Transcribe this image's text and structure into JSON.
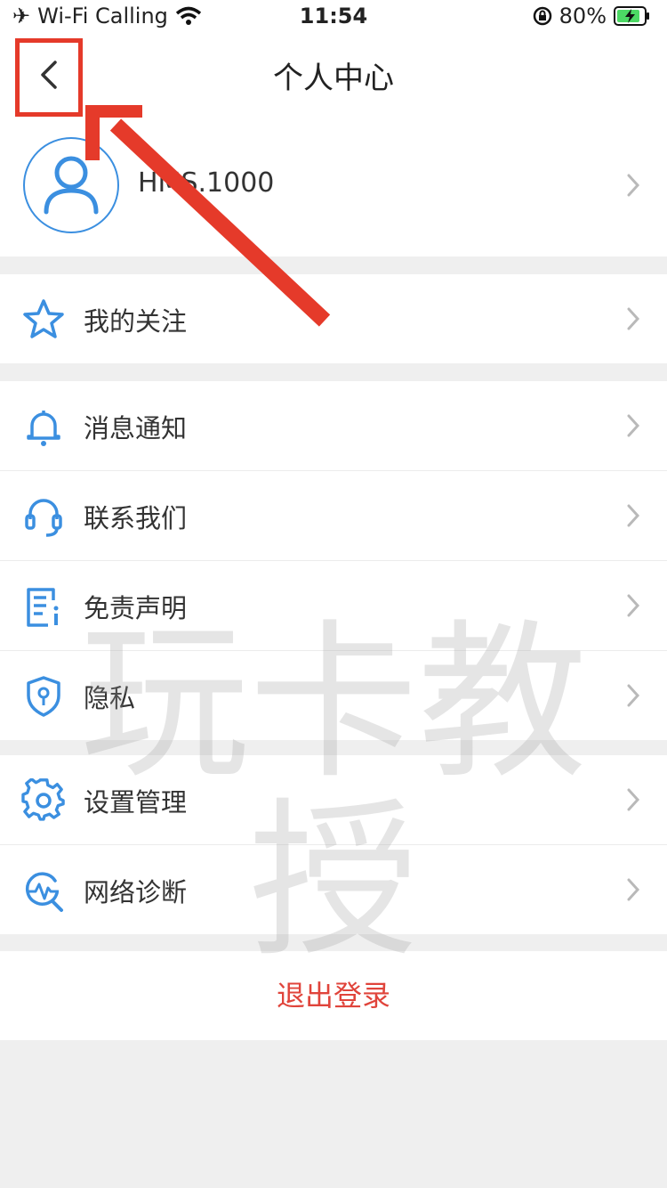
{
  "status_bar": {
    "carrier": "Wi-Fi Calling",
    "time": "11:54",
    "battery": "80%"
  },
  "nav": {
    "title": "个人中心"
  },
  "profile": {
    "username": "HMS.1000"
  },
  "menu": {
    "follow": "我的关注",
    "notifications": "消息通知",
    "contact": "联系我们",
    "disclaimer": "免责声明",
    "privacy": "隐私",
    "settings": "设置管理",
    "network": "网络诊断"
  },
  "logout": "退出登录",
  "watermark": "玩卡教授",
  "colors": {
    "accent": "#3b8fe0",
    "logout": "#e0443b",
    "annotation": "#e53a2a"
  }
}
